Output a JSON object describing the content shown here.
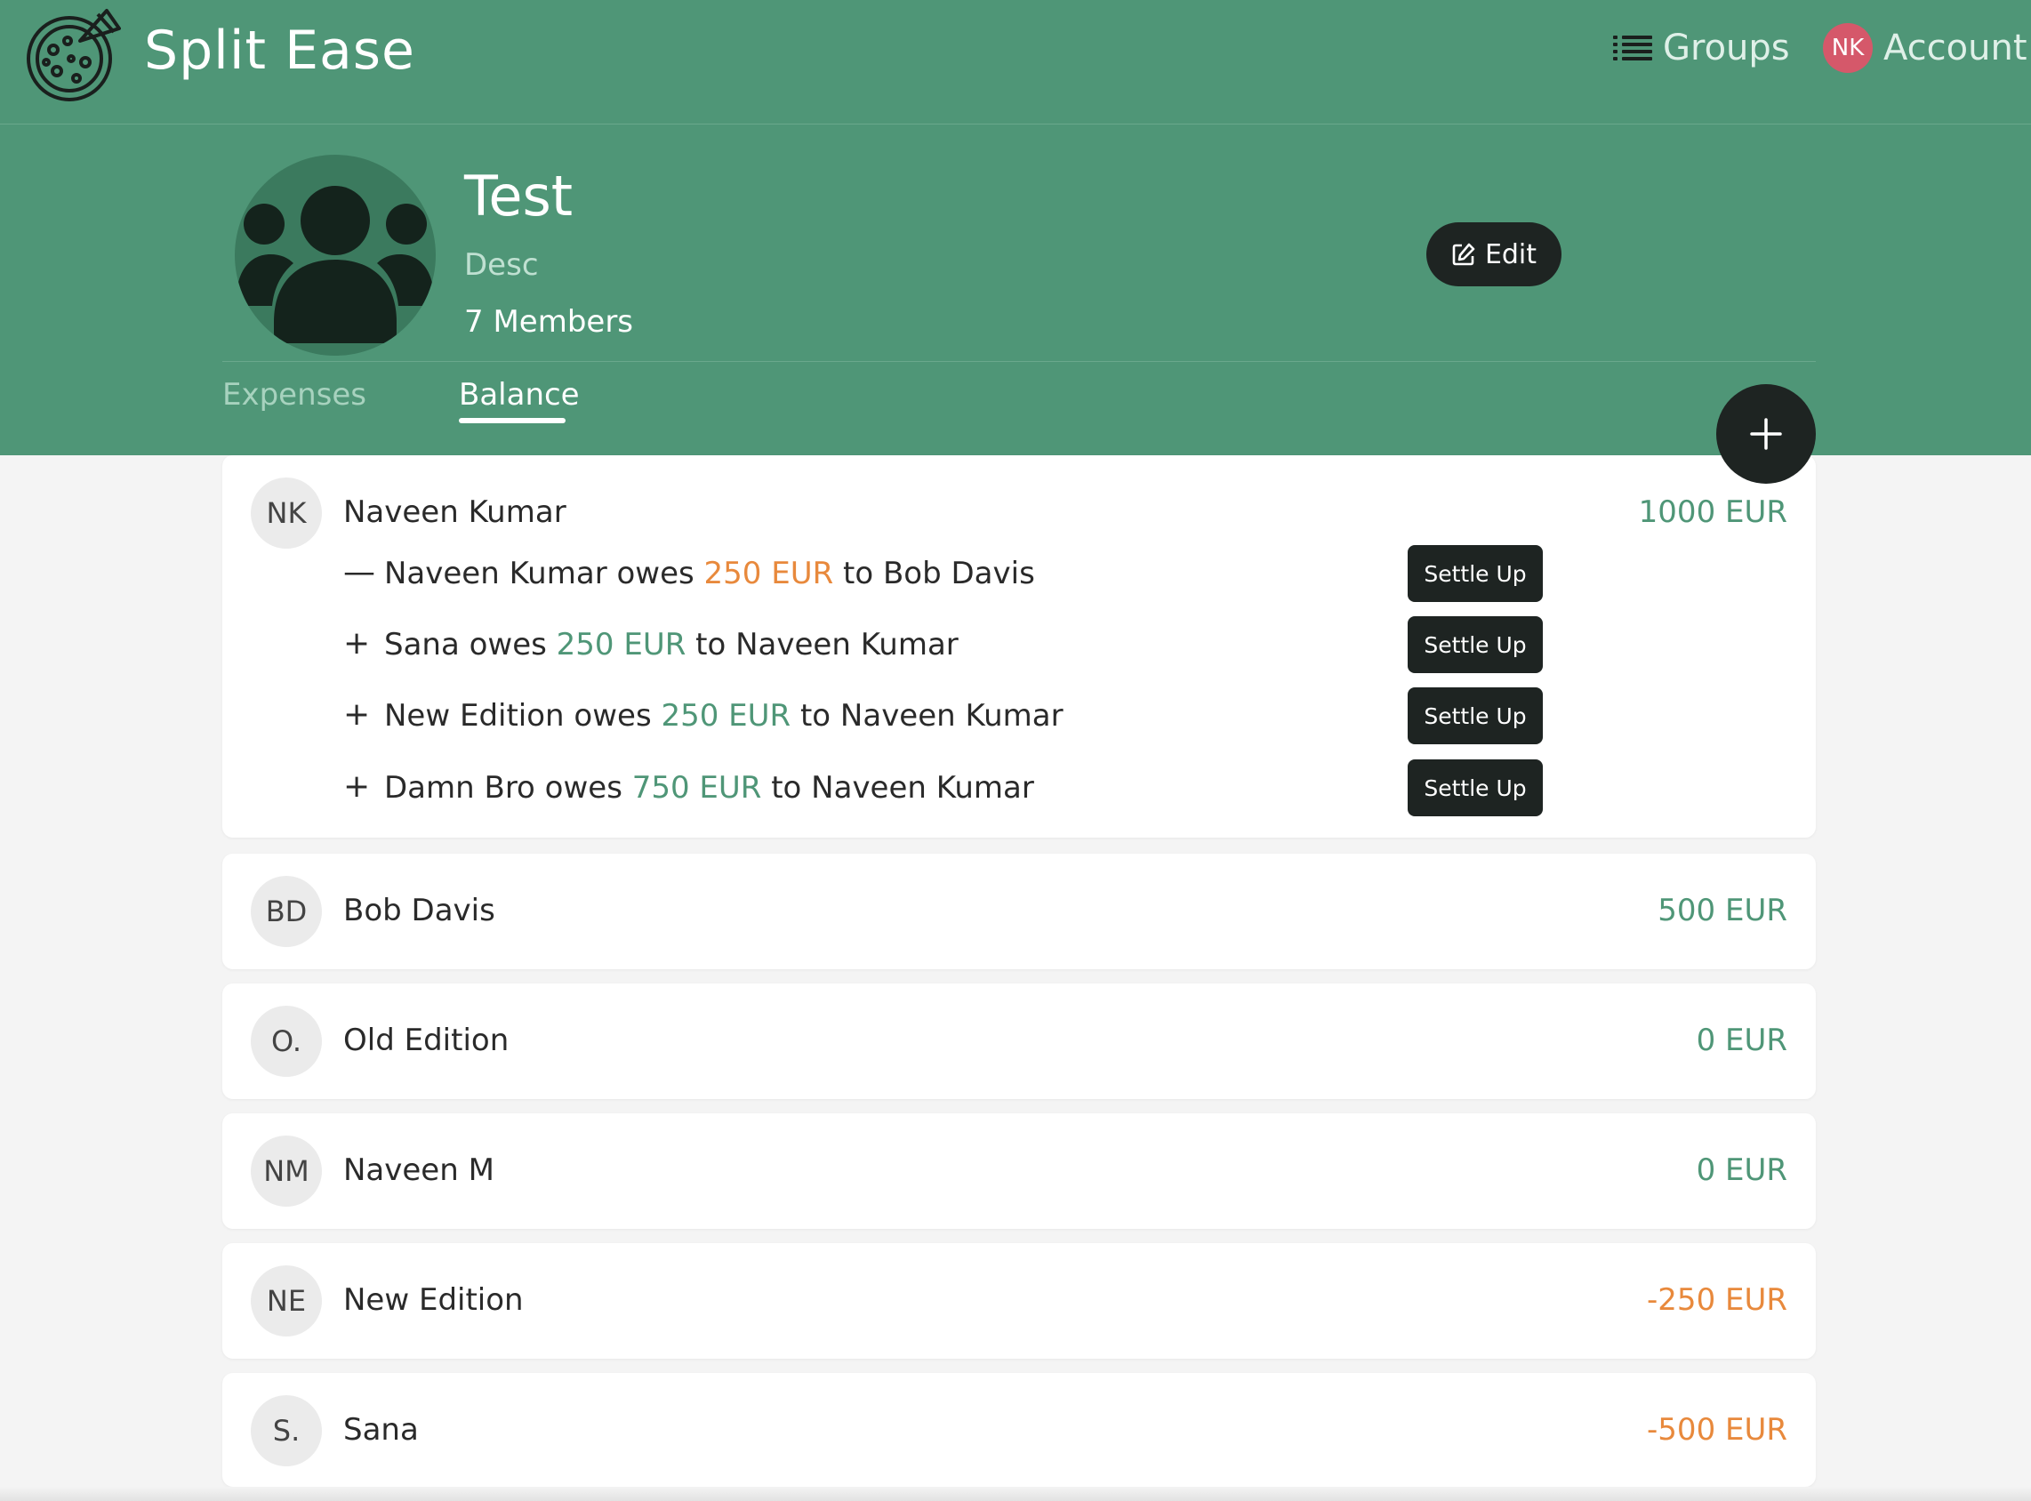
{
  "app": {
    "title": "Split Ease"
  },
  "nav": {
    "groups_label": "Groups",
    "account_label": "Account",
    "account_initials": "NK"
  },
  "group": {
    "name": "Test",
    "description": "Desc",
    "members_text": "7 Members",
    "edit_label": "Edit"
  },
  "tabs": [
    {
      "label": "Expenses",
      "active": false
    },
    {
      "label": "Balance",
      "active": true
    }
  ],
  "colors": {
    "brand": "#4f9677",
    "positive": "#4f9677",
    "negative": "#e8893c",
    "dark": "#1e2422",
    "account_avatar": "#d5586a"
  },
  "members": [
    {
      "initials": "NK",
      "name": "Naveen Kumar",
      "amount": "1000 EUR",
      "status": "positive",
      "debts": [
        {
          "sign": "—",
          "from": "Naveen Kumar",
          "owes": " owes ",
          "amount": "250 EUR",
          "to": " to Bob Davis",
          "amount_status": "negative",
          "action": "Settle Up"
        },
        {
          "sign": "+",
          "from": "Sana",
          "owes": " owes ",
          "amount": "250 EUR",
          "to": " to Naveen Kumar",
          "amount_status": "positive",
          "action": "Settle Up"
        },
        {
          "sign": "+",
          "from": "New Edition",
          "owes": " owes ",
          "amount": "250 EUR",
          "to": " to Naveen Kumar",
          "amount_status": "positive",
          "action": "Settle Up"
        },
        {
          "sign": "+",
          "from": "Damn Bro",
          "owes": " owes ",
          "amount": "750 EUR",
          "to": " to Naveen Kumar",
          "amount_status": "positive",
          "action": "Settle Up"
        }
      ]
    },
    {
      "initials": "BD",
      "name": "Bob Davis",
      "amount": "500 EUR",
      "status": "positive"
    },
    {
      "initials": "O.",
      "name": "Old Edition",
      "amount": "0 EUR",
      "status": "positive"
    },
    {
      "initials": "NM",
      "name": "Naveen M",
      "amount": "0 EUR",
      "status": "positive"
    },
    {
      "initials": "NE",
      "name": "New Edition",
      "amount": "-250 EUR",
      "status": "negative"
    },
    {
      "initials": "S.",
      "name": "Sana",
      "amount": "-500 EUR",
      "status": "negative"
    }
  ]
}
